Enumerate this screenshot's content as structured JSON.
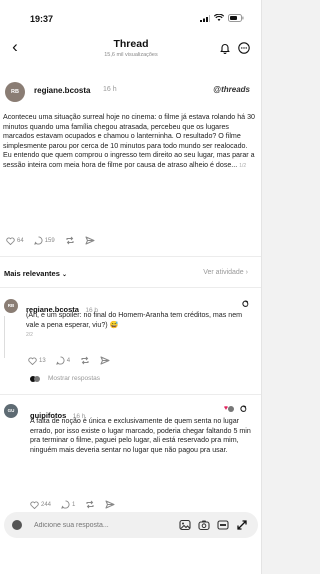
{
  "status_bar": {
    "time": "19:37"
  },
  "header": {
    "title": "Thread",
    "subtitle": "15,6 mil visualizações"
  },
  "main_post": {
    "username": "regiane.bcosta",
    "time": "16 h",
    "avatar_initials": "RB",
    "brand": "threads",
    "text": "Aconteceu uma situação surreal hoje no cinema: o filme já estava rolando há 30 minutos quando uma família chegou atrasada, percebeu que os lugares marcados estavam ocupados e chamou o lanterninha. O resultado? O filme simplesmente parou por cerca de 10 minutos para todo mundo ser realocado. Eu entendo que quem comprou o ingresso tem direito ao seu lugar, mas parar a sessão inteira com meia hora de filme por causa de atraso alheio é dose...",
    "page": "1/2",
    "likes": "64",
    "comments": "159",
    "repost": "",
    "share": ""
  },
  "sort": {
    "left": "Mais relevantes",
    "right": "Ver atividade"
  },
  "replies": [
    {
      "username": "regiane.bcosta",
      "time": "16 h",
      "avatar_initials": "RB",
      "text": "(Ah, e um spoiler: no final do Homem-Aranha tem créditos, mas nem vale a pena esperar, viu?) 😅",
      "page": "2/2",
      "likes": "13",
      "comments": "4",
      "reposts": "",
      "show_replies": "Mostrar respostas"
    },
    {
      "username": "guipifotos",
      "time": "16 h",
      "avatar_initials": "GU",
      "text": "A falta de noção é única e exclusivamente de quem senta no lugar errado, por isso existe o lugar marcado, poderia chegar faltando 5 min pra terminar o filme, paguei pelo lugar, ali está reservado pra mim, ninguém mais deveria sentar no lugar que não pagou pra usar.",
      "likes": "244",
      "comments": "1",
      "reposts": ""
    }
  ],
  "composer": {
    "placeholder": "Adicione sua resposta..."
  },
  "colors": {
    "accent_red": "#e0245e",
    "muted": "#999999",
    "text": "#111111"
  }
}
